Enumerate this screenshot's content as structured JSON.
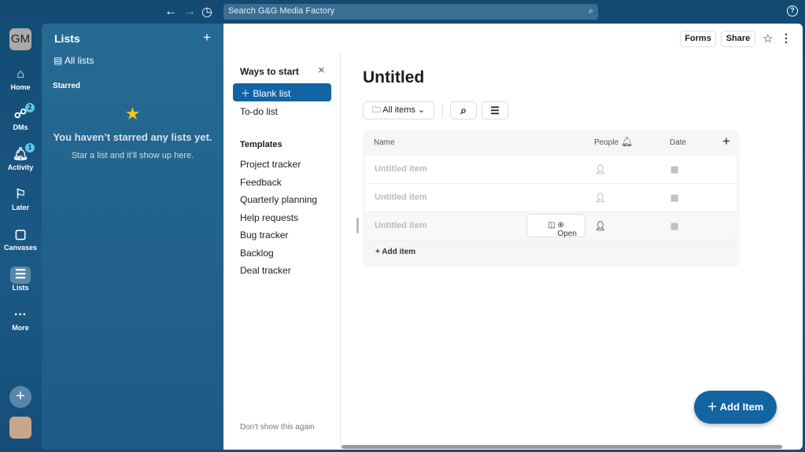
{
  "topbar": {
    "search_placeholder": "Search G&G Media Factory",
    "back": "←",
    "forward": "→",
    "history": "◷",
    "help": "?"
  },
  "workspace": {
    "initials": "GM"
  },
  "rail": [
    {
      "label": "Home",
      "icon": "home-icon",
      "glyph": "⌂"
    },
    {
      "label": "DMs",
      "icon": "dms-icon",
      "glyph": "☍",
      "badge": "2"
    },
    {
      "label": "Activity",
      "icon": "bell-icon",
      "glyph": "🔔︎",
      "badge": "1"
    },
    {
      "label": "Later",
      "icon": "bookmark-icon",
      "glyph": "⚐"
    },
    {
      "label": "Canvases",
      "icon": "canvas-icon",
      "glyph": "▢"
    },
    {
      "label": "Lists",
      "icon": "lists-icon",
      "glyph": "☰"
    },
    {
      "label": "More",
      "icon": "more-icon",
      "glyph": "···"
    }
  ],
  "lists_panel": {
    "title": "Lists",
    "all_lists": "All lists",
    "starred": "Starred",
    "empty_title": "You haven’t starred any lists yet.",
    "empty_sub": "Star a list and it’ll show up here."
  },
  "header": {
    "forms": "Forms",
    "share": "Share"
  },
  "ways": {
    "title": "Ways to start",
    "blank": "Blank list",
    "todo": "To-do list",
    "templates_title": "Templates",
    "templates": [
      "Project tracker",
      "Feedback",
      "Quarterly planning",
      "Help requests",
      "Bug tracker",
      "Backlog",
      "Deal tracker"
    ],
    "dont_show": "Don't show this again"
  },
  "list": {
    "title": "Untitled",
    "filter": "All items",
    "columns": [
      "Name",
      "People",
      "Date"
    ],
    "rows": [
      "Untitled item",
      "Untitled item",
      "Untitled item"
    ],
    "open": "Open",
    "add_item": "Add item",
    "fab": "Add Item"
  },
  "colors": {
    "accent": "#1264a3",
    "fab": "#1264a3"
  }
}
